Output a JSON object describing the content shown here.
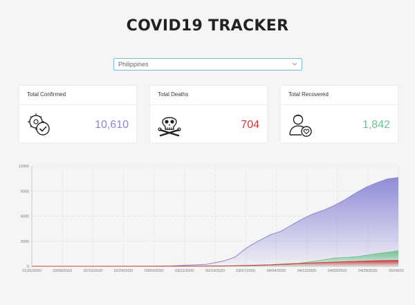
{
  "header": {
    "title": "COVID19 TRACKER"
  },
  "country_select": {
    "value": "Philippines"
  },
  "cards": [
    {
      "label": "Total Confirmed",
      "value": "10,610",
      "color": "#8a86d6",
      "icon": "virus-check-icon"
    },
    {
      "label": "Total Deaths",
      "value": "704",
      "color": "#d23a3a",
      "icon": "skull-crossbones-icon"
    },
    {
      "label": "Total Recovered",
      "value": "1,842",
      "color": "#6fc38d",
      "icon": "recovered-person-heart-icon"
    }
  ],
  "chart_data": {
    "type": "area",
    "title": "",
    "xlabel": "",
    "ylabel": "",
    "ylim": [
      0,
      12000
    ],
    "yticks": [
      0,
      3000,
      6000,
      9000,
      12000
    ],
    "x_start": "2020-01-31",
    "x_end": "2020-05-13",
    "xticks": [
      "01/31/2020",
      "02/08/2020",
      "02/16/2020",
      "02/24/2020",
      "03/03/2020",
      "03/11/2020",
      "03/19/2020",
      "03/27/2020",
      "04/04/2020",
      "04/12/2020",
      "04/20/2020",
      "04/28/2020",
      "05/09/2020"
    ],
    "grid": true,
    "series": [
      {
        "color": "#8a86d6",
        "points": [
          [
            "2020-01-31",
            1
          ],
          [
            "2020-03-05",
            3
          ],
          [
            "2020-03-10",
            33
          ],
          [
            "2020-03-15",
            140
          ],
          [
            "2020-03-20",
            230
          ],
          [
            "2020-03-25",
            636
          ],
          [
            "2020-03-28",
            1075
          ],
          [
            "2020-03-31",
            2084
          ],
          [
            "2020-04-02",
            2633
          ],
          [
            "2020-04-04",
            3094
          ],
          [
            "2020-04-07",
            3764
          ],
          [
            "2020-04-10",
            4195
          ],
          [
            "2020-04-13",
            4932
          ],
          [
            "2020-04-16",
            5660
          ],
          [
            "2020-04-19",
            6259
          ],
          [
            "2020-04-22",
            6710
          ],
          [
            "2020-04-25",
            7294
          ],
          [
            "2020-04-28",
            7958
          ],
          [
            "2020-05-01",
            8772
          ],
          [
            "2020-05-04",
            9485
          ],
          [
            "2020-05-07",
            10004
          ],
          [
            "2020-05-10",
            10463
          ],
          [
            "2020-05-13",
            10610
          ]
        ]
      },
      {
        "color": "#6fc38d",
        "points": [
          [
            "2020-01-31",
            0
          ],
          [
            "2020-03-20",
            8
          ],
          [
            "2020-03-31",
            52
          ],
          [
            "2020-04-07",
            140
          ],
          [
            "2020-04-13",
            242
          ],
          [
            "2020-04-19",
            572
          ],
          [
            "2020-04-25",
            975
          ],
          [
            "2020-05-01",
            1124
          ],
          [
            "2020-05-07",
            1506
          ],
          [
            "2020-05-13",
            1842
          ]
        ]
      },
      {
        "color": "#d23a3a",
        "points": [
          [
            "2020-01-31",
            0
          ],
          [
            "2020-03-15",
            12
          ],
          [
            "2020-03-25",
            38
          ],
          [
            "2020-03-31",
            88
          ],
          [
            "2020-04-07",
            177
          ],
          [
            "2020-04-13",
            315
          ],
          [
            "2020-04-19",
            409
          ],
          [
            "2020-04-25",
            494
          ],
          [
            "2020-05-01",
            579
          ],
          [
            "2020-05-07",
            658
          ],
          [
            "2020-05-13",
            704
          ]
        ]
      }
    ]
  }
}
